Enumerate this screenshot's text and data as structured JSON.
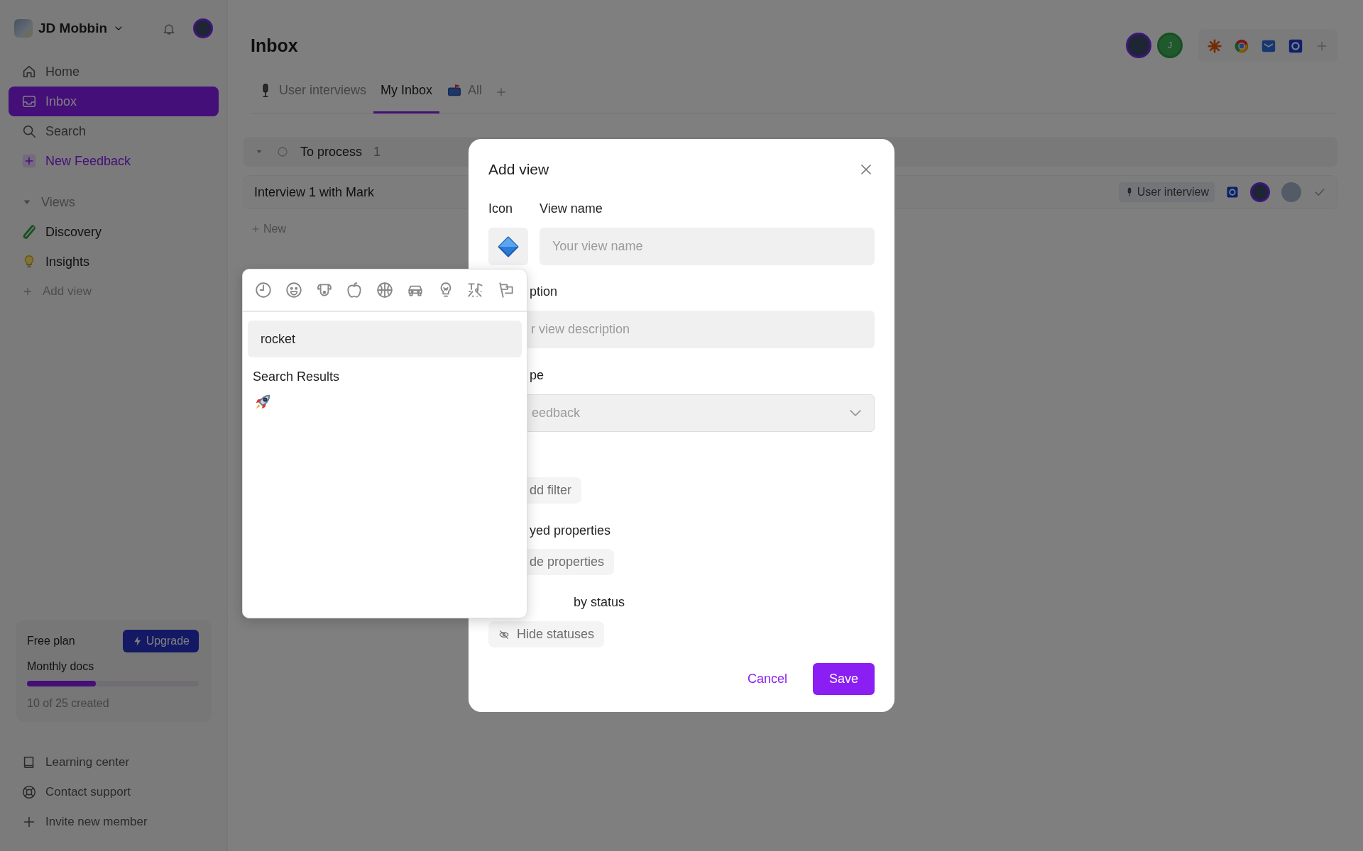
{
  "workspace": {
    "name": "JD Mobbin"
  },
  "sidebar": {
    "nav": [
      {
        "label": "Home",
        "kind": "home",
        "selected": false
      },
      {
        "label": "Inbox",
        "kind": "inbox",
        "selected": true
      },
      {
        "label": "Search",
        "kind": "search",
        "selected": false
      },
      {
        "label": "New Feedback",
        "kind": "new",
        "selected": false
      }
    ],
    "views_heading": "Views",
    "views_expanded": true,
    "views": [
      {
        "label": "Discovery",
        "kind": "tube"
      },
      {
        "label": "Insights",
        "kind": "bulb"
      }
    ],
    "add_view": "Add view",
    "plan": {
      "name": "Free plan",
      "upgrade": "Upgrade",
      "metric": "Monthly docs",
      "level": 0.4,
      "usage": "10 of 25 created"
    },
    "footer": [
      {
        "label": "Learning center",
        "kind": "book"
      },
      {
        "label": "Contact support",
        "kind": "support"
      },
      {
        "label": "Invite new member",
        "kind": "plus"
      }
    ]
  },
  "page": {
    "title": "Inbox",
    "collaborator_initial": "J",
    "tabs": [
      {
        "label": "User interviews",
        "kind": "mic",
        "selected": false
      },
      {
        "label": "My Inbox",
        "kind": "none",
        "selected": true
      },
      {
        "label": "All",
        "kind": "mailbox",
        "selected": false
      }
    ],
    "groups": [
      {
        "title": "To process",
        "count": "1",
        "expanded": true,
        "rows": [
          {
            "title": "Interview 1 with Mark",
            "tag": "User interview",
            "done": true
          }
        ]
      }
    ],
    "new_label": "New"
  },
  "modal": {
    "title": "Add view",
    "icon_label": "Icon",
    "name_label": "View name",
    "name_placeholder": "Your view name",
    "description_label": "ption",
    "description_placeholder": "r view description",
    "type_label": "pe",
    "type_value": "eedback",
    "filter_button": "dd filter",
    "properties_label": "yed properties",
    "properties_button": "de properties",
    "status_label": "by status",
    "status_button": "Hide statuses",
    "cancel": "Cancel",
    "save": "Save"
  },
  "emoji_picker": {
    "search_value": "rocket",
    "results_heading": "Search Results"
  }
}
